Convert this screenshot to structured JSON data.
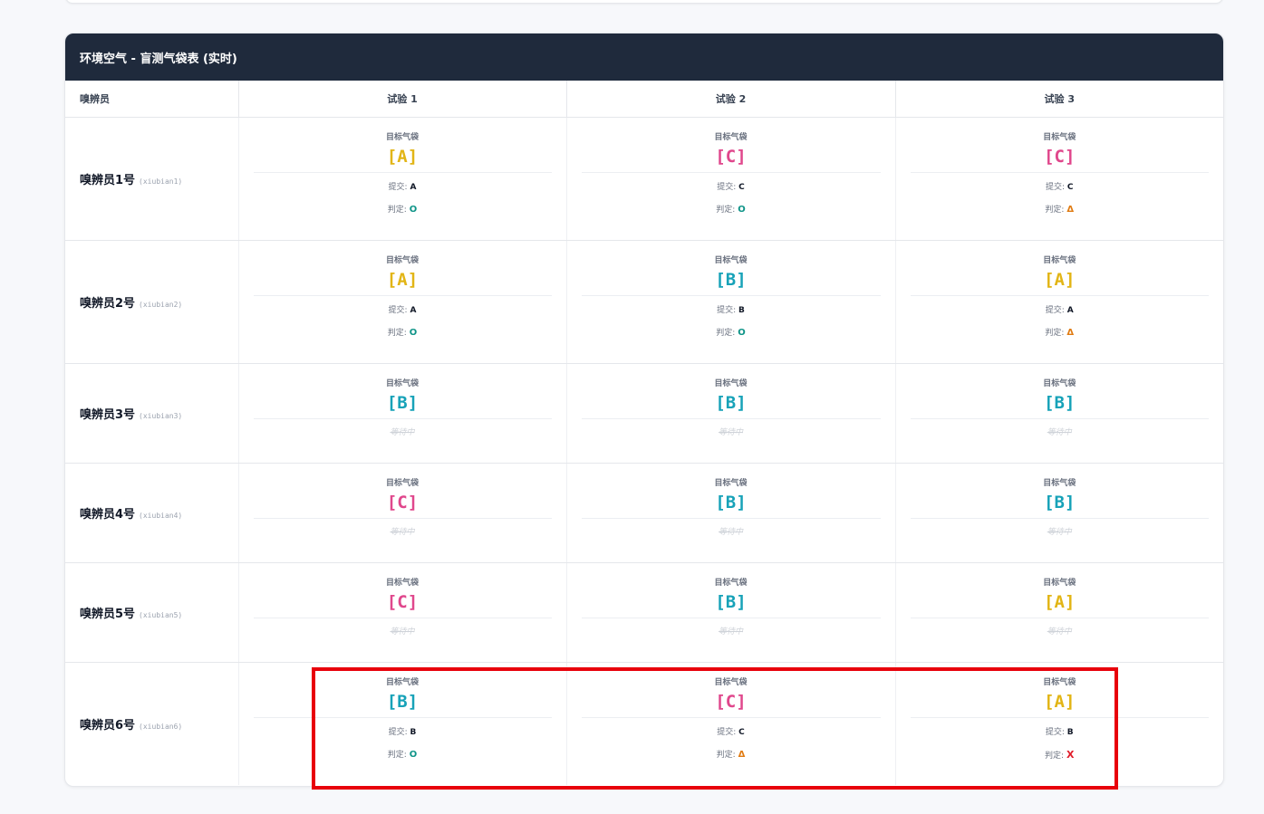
{
  "panel": {
    "title": "环境空气 - 盲测气袋表 (实时)"
  },
  "table": {
    "col_sniffer": "嗅辨员",
    "col_trials": [
      "试验 1",
      "试验 2",
      "试验 3"
    ]
  },
  "labels": {
    "target": "目标气袋",
    "submit": "提交:",
    "judge": "判定:",
    "waiting": "等待中"
  },
  "rows": [
    {
      "name": "嗅辨员1号",
      "id": "(xiubian1)",
      "cells": [
        {
          "target": "[A]",
          "bag": "A",
          "submit": "A",
          "judge": "O"
        },
        {
          "target": "[C]",
          "bag": "C",
          "submit": "C",
          "judge": "O"
        },
        {
          "target": "[C]",
          "bag": "C",
          "submit": "C",
          "judge": "Δ"
        }
      ]
    },
    {
      "name": "嗅辨员2号",
      "id": "(xiubian2)",
      "cells": [
        {
          "target": "[A]",
          "bag": "A",
          "submit": "A",
          "judge": "O"
        },
        {
          "target": "[B]",
          "bag": "B",
          "submit": "B",
          "judge": "O"
        },
        {
          "target": "[A]",
          "bag": "A",
          "submit": "A",
          "judge": "Δ"
        }
      ]
    },
    {
      "name": "嗅辨员3号",
      "id": "(xiubian3)",
      "cells": [
        {
          "target": "[B]",
          "bag": "B"
        },
        {
          "target": "[B]",
          "bag": "B"
        },
        {
          "target": "[B]",
          "bag": "B"
        }
      ]
    },
    {
      "name": "嗅辨员4号",
      "id": "(xiubian4)",
      "cells": [
        {
          "target": "[C]",
          "bag": "C"
        },
        {
          "target": "[B]",
          "bag": "B"
        },
        {
          "target": "[B]",
          "bag": "B"
        }
      ]
    },
    {
      "name": "嗅辨员5号",
      "id": "(xiubian5)",
      "cells": [
        {
          "target": "[C]",
          "bag": "C"
        },
        {
          "target": "[B]",
          "bag": "B"
        },
        {
          "target": "[A]",
          "bag": "A"
        }
      ]
    },
    {
      "name": "嗅辨员6号",
      "id": "(xiubian6)",
      "cells": [
        {
          "target": "[B]",
          "bag": "B",
          "submit": "B",
          "judge": "O"
        },
        {
          "target": "[C]",
          "bag": "C",
          "submit": "C",
          "judge": "Δ"
        },
        {
          "target": "[A]",
          "bag": "A",
          "submit": "B",
          "judge": "X"
        }
      ]
    }
  ],
  "colors": {
    "bag_A": "#e2b516",
    "bag_B": "#17a2b8",
    "bag_C": "#e0478c",
    "judge_O": "#0f9488",
    "judge_Δ": "#e07b12",
    "judge_X": "#e11d2a",
    "header_bg": "#1f2a3c",
    "highlight": "#e8000b"
  }
}
